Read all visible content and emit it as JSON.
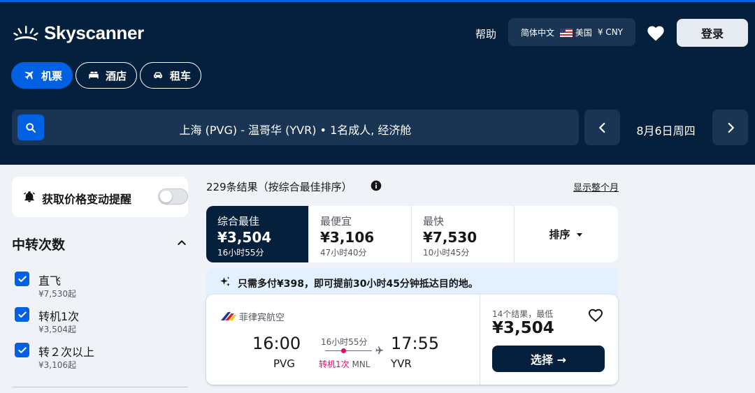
{
  "brand": {
    "name": "Skyscanner"
  },
  "header": {
    "help": "帮助",
    "language": "简体中文",
    "region": "美国",
    "currency": "¥ CNY",
    "login": "登录"
  },
  "modes": [
    {
      "label": "机票",
      "icon": "plane-icon",
      "active": true
    },
    {
      "label": "酒店",
      "icon": "bed-icon",
      "active": false
    },
    {
      "label": "租车",
      "icon": "car-icon",
      "active": false
    }
  ],
  "search": {
    "summary": "上海 (PVG) - 温哥华 (YVR) • 1名成人, 经济舱",
    "date": "8月6日周四"
  },
  "sidebar": {
    "price_alert": "获取价格变动提醒",
    "stops_title": "中转次数",
    "stops": [
      {
        "label": "直飞",
        "price": "¥7,530起",
        "checked": true
      },
      {
        "label": "转机1次",
        "price": "¥3,504起",
        "checked": true
      },
      {
        "label": "转２次以上",
        "price": "¥3,106起",
        "checked": true
      }
    ]
  },
  "results": {
    "count": "229条结果（按综合最佳排序）",
    "month_link": "显示整个月",
    "tabs": [
      {
        "title": "综合最佳",
        "price": "¥3,504",
        "duration": "16小时55分",
        "active": true
      },
      {
        "title": "最便宜",
        "price": "¥3,106",
        "duration": "47小时40分",
        "active": false
      },
      {
        "title": "最快",
        "price": "¥7,530",
        "duration": "10小时45分",
        "active": false
      }
    ],
    "sort_label": "排序",
    "banner": "只需多付¥398，即可提前30小时45分钟抵达目的地。"
  },
  "flight": {
    "airline": "菲律宾航空",
    "dep_time": "16:00",
    "dep_code": "PVG",
    "arr_time": "17:55",
    "arr_code": "YVR",
    "duration": "16小时55分",
    "stops": "转机1次",
    "via": "MNL",
    "count_low": "14个结果，最低",
    "price": "¥3,504",
    "select": "选择 →"
  },
  "colors": {
    "header_bg": "#05203c",
    "accent_blue": "#0062e3",
    "stop_pink": "#e70866",
    "banner_bg": "#e3f0ff"
  }
}
